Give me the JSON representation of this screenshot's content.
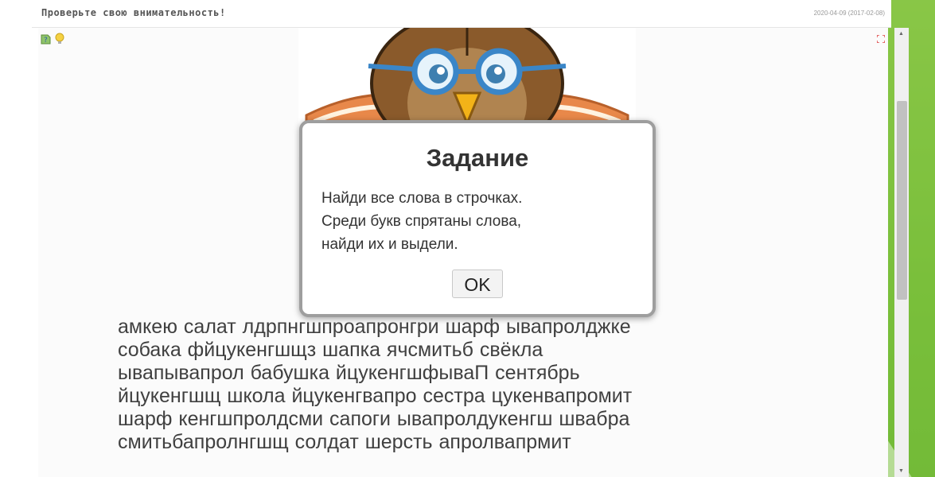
{
  "header": {
    "title": "Проверьте свою внимательность!",
    "timestamp": "2020-04-09 (2017-02-08)"
  },
  "toolbar": {
    "icons": [
      "help-icon",
      "hint-bulb-icon"
    ],
    "fullscreen_icon": "fullscreen-icon"
  },
  "dialog": {
    "title": "Задание",
    "lines": [
      "Найди все слова в строчках.",
      "Среди букв спрятаны слова,",
      "найди их и выдели."
    ],
    "ok_label": "OK"
  },
  "puzzle": {
    "lines": [
      "амкею салат лдрпнгшпроапронгри шарф ывапролджке",
      "собака фйцукенгшщз шапка ячсмитьб свёкла",
      "ывапывапрол бабушка йцукенгшфываП сентябрь",
      "йцукенгшщ школа йцукенгвапро сестра цукенвапромит",
      "шарф кенгшпролдсми сапоги ывапролдукенгш швабра",
      "смитьбапролнгшщ солдат шерсть апролвапрмит"
    ]
  },
  "colors": {
    "accent_green": "#7cc13a",
    "owl_brown": "#8a5a2b",
    "glasses_blue": "#3a86c8"
  }
}
